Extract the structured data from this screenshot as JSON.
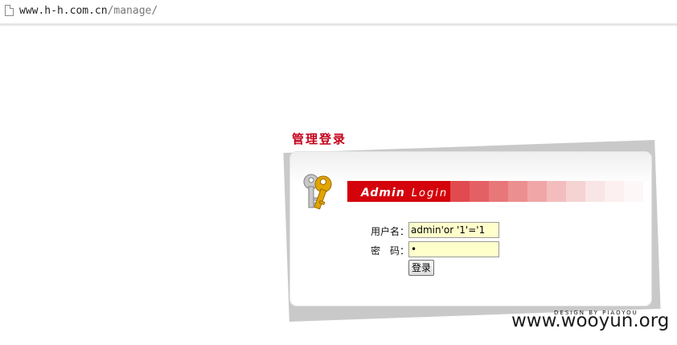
{
  "browser": {
    "url_host": "www.h-h.com.cn",
    "url_path": "/manage/"
  },
  "login": {
    "title": "管理登录",
    "banner_bold": "Admin",
    "banner_light": "Login",
    "username_label": "用户名：",
    "password_label": "密　码：",
    "username_value": "admin'or '1'='1",
    "password_value": "•",
    "submit_label": "登录",
    "design_credit": "DESIGN BY PIAOYOU"
  },
  "watermark": "www.wooyun.org",
  "colors": {
    "accent_red": "#d4020b",
    "title_red": "#c4001a",
    "input_bg": "#ffffcc",
    "banner_gradient": [
      "#d4020b",
      "#e14a4f",
      "#e56064",
      "#e8777a",
      "#ec8f90",
      "#f0a6a7",
      "#f3bdbd",
      "#f6d3d3",
      "#f9e5e5",
      "#fcf0f0",
      "#fdf7f7",
      "#ffffff"
    ]
  },
  "icons": {
    "page": "page-icon",
    "keys": "keys-icon"
  }
}
